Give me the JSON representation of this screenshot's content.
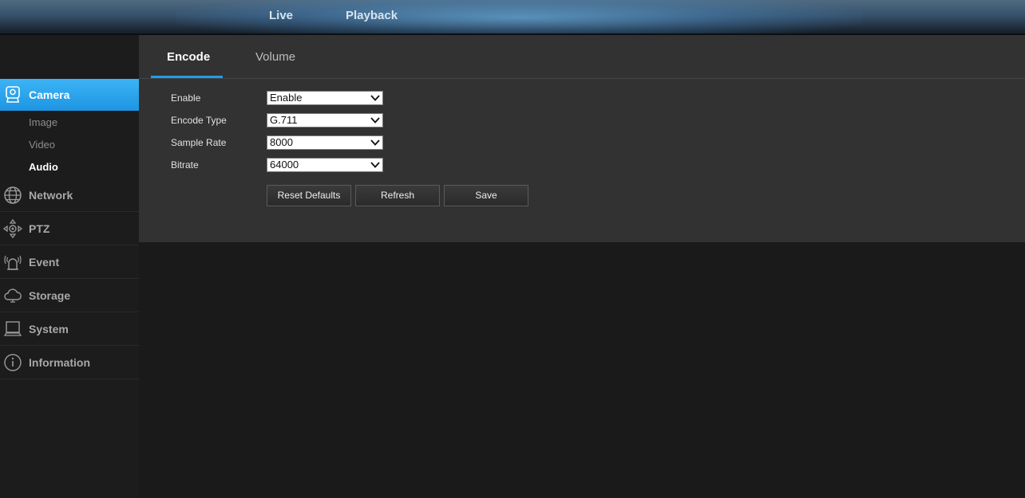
{
  "topnav": {
    "live": "Live",
    "playback": "Playback"
  },
  "sidebar": {
    "camera": {
      "label": "Camera",
      "icon": "camera-icon"
    },
    "submenu": [
      {
        "label": "Image",
        "active": false
      },
      {
        "label": "Video",
        "active": false
      },
      {
        "label": "Audio",
        "active": true
      }
    ],
    "items": [
      {
        "label": "Network",
        "icon": "network-globe-icon"
      },
      {
        "label": "PTZ",
        "icon": "ptz-arrows-icon"
      },
      {
        "label": "Event",
        "icon": "alarm-bell-icon"
      },
      {
        "label": "Storage",
        "icon": "cloud-storage-icon"
      },
      {
        "label": "System",
        "icon": "computer-icon"
      },
      {
        "label": "Information",
        "icon": "info-icon"
      }
    ]
  },
  "tabs": {
    "encode": "Encode",
    "volume": "Volume"
  },
  "form": {
    "enable": {
      "label": "Enable",
      "value": "Enable"
    },
    "encode_type": {
      "label": "Encode Type",
      "value": "G.711"
    },
    "sample_rate": {
      "label": "Sample Rate",
      "value": "8000"
    },
    "bitrate": {
      "label": "Bitrate",
      "value": "64000"
    }
  },
  "buttons": {
    "reset": "Reset Defaults",
    "refresh": "Refresh",
    "save": "Save"
  },
  "colors": {
    "accent": "#1f9de6",
    "panel": "#323232",
    "background": "#1a1a1a"
  }
}
